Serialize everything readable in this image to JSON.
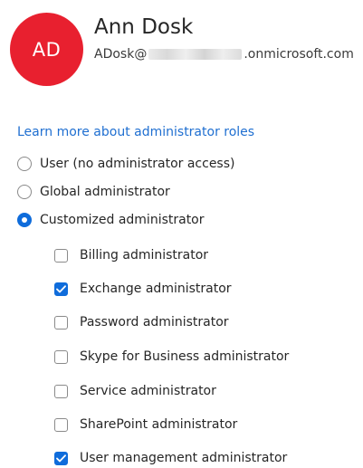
{
  "user": {
    "initials": "AD",
    "avatar_color": "#e8202f",
    "name": "Ann Dosk",
    "email_prefix": "ADosk@",
    "email_suffix": ".onmicrosoft.com"
  },
  "learn_more_link": "Learn more about administrator roles",
  "role_options": [
    {
      "label": "User (no administrator access)",
      "selected": false
    },
    {
      "label": "Global administrator",
      "selected": false
    },
    {
      "label": "Customized administrator",
      "selected": true
    }
  ],
  "custom_roles": [
    {
      "label": "Billing administrator",
      "checked": false
    },
    {
      "label": "Exchange administrator",
      "checked": true
    },
    {
      "label": "Password administrator",
      "checked": false
    },
    {
      "label": "Skype for Business administrator",
      "checked": false
    },
    {
      "label": "Service administrator",
      "checked": false
    },
    {
      "label": "SharePoint administrator",
      "checked": false
    },
    {
      "label": "User management administrator",
      "checked": true
    }
  ],
  "colors": {
    "accent": "#0f6cdb",
    "link": "#1f6fd1"
  }
}
